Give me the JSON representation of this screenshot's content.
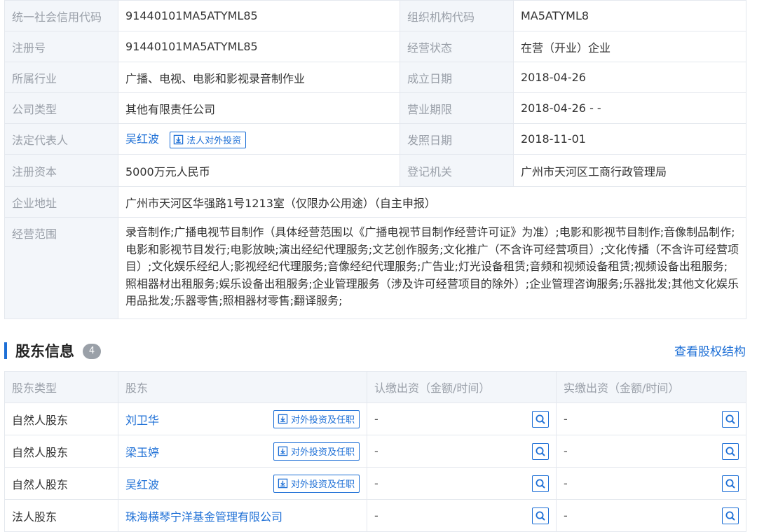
{
  "info": {
    "credit_code_label": "统一社会信用代码",
    "credit_code": "91440101MA5ATYML85",
    "org_code_label": "组织机构代码",
    "org_code": "MA5ATYML8",
    "reg_no_label": "注册号",
    "reg_no": "91440101MA5ATYML85",
    "status_label": "经营状态",
    "status": "在营（开业）企业",
    "industry_label": "所属行业",
    "industry": "广播、电视、电影和影视录音制作业",
    "founded_label": "成立日期",
    "founded": "2018-04-26",
    "company_type_label": "公司类型",
    "company_type": "其他有限责任公司",
    "term_label": "营业期限",
    "term": "2018-04-26 - -",
    "legal_rep_label": "法定代表人",
    "legal_rep": "吴红波",
    "legal_rep_btn": "法人对外投资",
    "license_date_label": "发照日期",
    "license_date": "2018-11-01",
    "capital_label": "注册资本",
    "capital": "5000万元人民币",
    "authority_label": "登记机关",
    "authority": "广州市天河区工商行政管理局",
    "address_label": "企业地址",
    "address": "广州市天河区华强路1号1213室（仅限办公用途）（自主申报）",
    "scope_label": "经营范围",
    "scope": "录音制作;广播电视节目制作（具体经营范围以《广播电视节目制作经营许可证》为准）;电影和影视节目制作;音像制品制作;电影和影视节目发行;电影放映;演出经纪代理服务;文艺创作服务;文化推广（不含许可经营项目）;文化传播（不含许可经营项目）;文化娱乐经纪人;影视经纪代理服务;音像经纪代理服务;广告业;灯光设备租赁;音频和视频设备租赁;视频设备出租服务;照相器材出租服务;娱乐设备出租服务;企业管理服务（涉及许可经营项目的除外）;企业管理咨询服务;乐器批发;其他文化娱乐用品批发;乐器零售;照相器材零售;翻译服务;"
  },
  "shareholders": {
    "title": "股东信息",
    "count": "4",
    "view_structure": "查看股权结构",
    "headers": [
      "股东类型",
      "股东",
      "认缴出资（金额/时间）",
      "实缴出资（金额/时间）"
    ],
    "invest_btn": "对外投资及任职",
    "rows": [
      {
        "type": "自然人股东",
        "name": "刘卫华",
        "subscribed": "-",
        "paid": "-"
      },
      {
        "type": "自然人股东",
        "name": "梁玉婷",
        "subscribed": "-",
        "paid": "-"
      },
      {
        "type": "自然人股东",
        "name": "吴红波",
        "subscribed": "-",
        "paid": "-"
      },
      {
        "type": "法人股东",
        "name": "珠海横琴宁洋基金管理有限公司",
        "subscribed": "-",
        "paid": "-"
      }
    ]
  },
  "colors": {
    "accent": "#1d6fd6",
    "label_bg": "#f3f6fa",
    "label_text": "#999fa8"
  },
  "icons": {
    "invest": "download-box-icon",
    "search": "search-icon"
  }
}
